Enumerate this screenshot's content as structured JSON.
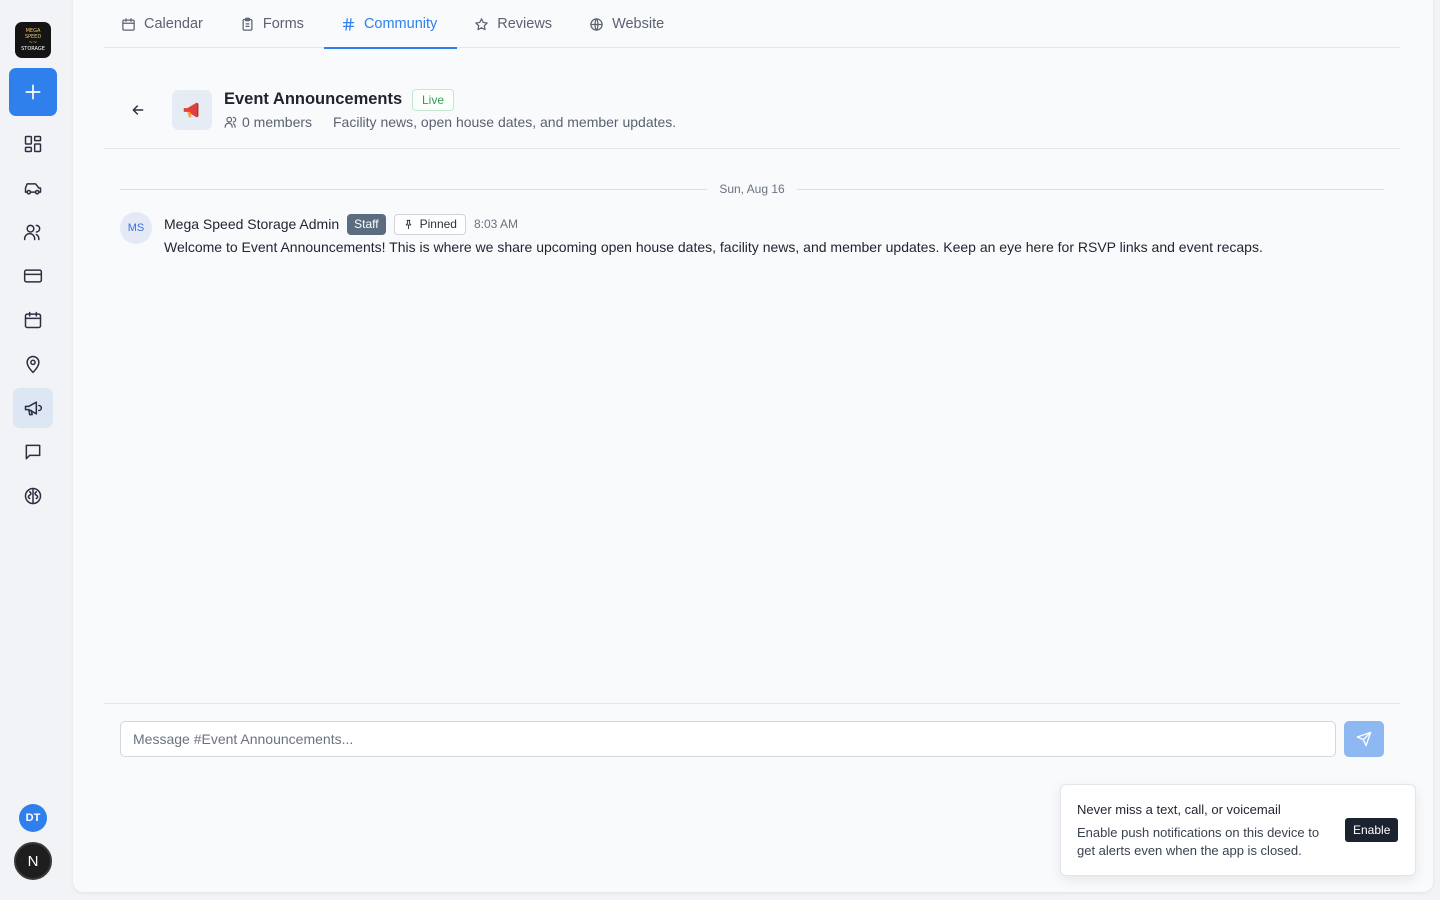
{
  "sidebar": {
    "logo": {
      "line1": "MEGA SPEED",
      "line2": "~~",
      "line3": "STORAGE"
    },
    "new_button_icon": "plus-icon",
    "items": [
      {
        "name": "dashboard",
        "icon": "grid-icon"
      },
      {
        "name": "vehicles",
        "icon": "car-icon"
      },
      {
        "name": "contacts",
        "icon": "users-icon"
      },
      {
        "name": "billing",
        "icon": "credit-card-icon"
      },
      {
        "name": "calendar",
        "icon": "calendar-icon"
      },
      {
        "name": "locations",
        "icon": "map-pin-icon"
      },
      {
        "name": "marketing",
        "icon": "megaphone-icon",
        "active": true
      },
      {
        "name": "messages",
        "icon": "message-icon"
      },
      {
        "name": "ai",
        "icon": "brain-icon"
      }
    ],
    "user_initials": "DT",
    "account_initial": "N"
  },
  "tabs": [
    {
      "label": "Calendar",
      "icon": "calendar-icon"
    },
    {
      "label": "Forms",
      "icon": "clipboard-icon"
    },
    {
      "label": "Community",
      "icon": "hash-icon",
      "active": true
    },
    {
      "label": "Reviews",
      "icon": "star-icon"
    },
    {
      "label": "Website",
      "icon": "globe-icon"
    }
  ],
  "channel": {
    "emoji": "📣",
    "title": "Event Announcements",
    "status": "Live",
    "members": "0 members",
    "description": "Facility news, open house dates, and member updates."
  },
  "messages": {
    "date_divider": "Sun, Aug 16",
    "items": [
      {
        "avatar": "MS",
        "author": "Mega Speed Storage Admin",
        "role_badge": "Staff",
        "pinned_label": "Pinned",
        "time": "8:03 AM",
        "text": "Welcome to Event Announcements! This is where we share upcoming open house dates, facility news, and member updates. Keep an eye here for RSVP links and event recaps."
      }
    ]
  },
  "composer": {
    "placeholder": "Message #Event Announcements...",
    "send_icon": "send-icon"
  },
  "toast": {
    "title": "Never miss a text, call, or voicemail",
    "body": "Enable push notifications on this device to get alerts even when the app is closed.",
    "button": "Enable"
  },
  "colors": {
    "accent": "#2f80ed",
    "live_green": "#2f9e55",
    "staff_badge": "#5b6b80"
  }
}
